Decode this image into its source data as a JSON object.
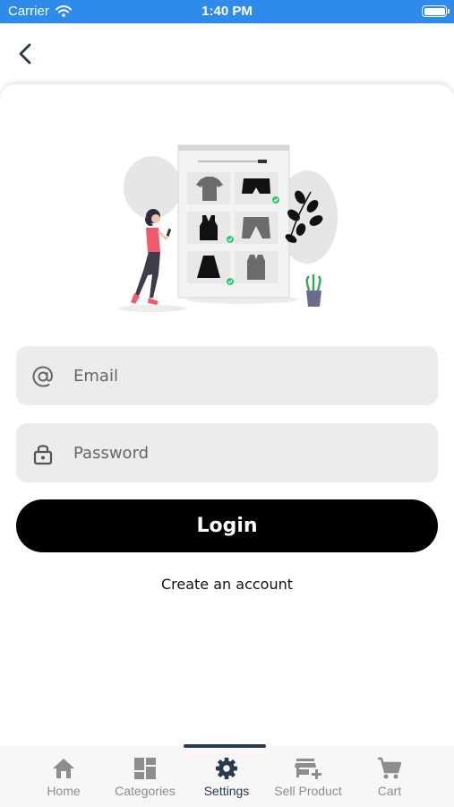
{
  "status_bar": {
    "carrier": "Carrier",
    "time": "1:40 PM",
    "icons": [
      "wifi-icon",
      "battery-icon"
    ]
  },
  "nav": {
    "back_icon": "chevron-left-icon"
  },
  "login_form": {
    "email": {
      "icon": "at-sign-icon",
      "placeholder": "Email",
      "value": ""
    },
    "password": {
      "icon": "lock-icon",
      "placeholder": "Password",
      "value": ""
    },
    "login_label": "Login",
    "create_account_label": "Create an account"
  },
  "tab_bar": {
    "active_tab": "Settings",
    "tabs": [
      {
        "label": "Home",
        "icon": "home-icon"
      },
      {
        "label": "Categories",
        "icon": "dashboard-icon"
      },
      {
        "label": "Settings",
        "icon": "gear-icon"
      },
      {
        "label": "Sell Product",
        "icon": "store-add-icon"
      },
      {
        "label": "Cart",
        "icon": "cart-icon"
      }
    ]
  },
  "colors": {
    "status_bar": "#2e8bea",
    "accent": "#2a3a4e",
    "field_bg": "#ececec",
    "button_bg": "#000000",
    "figure_accent": "#f05a6e",
    "check_green": "#2ecc71"
  }
}
